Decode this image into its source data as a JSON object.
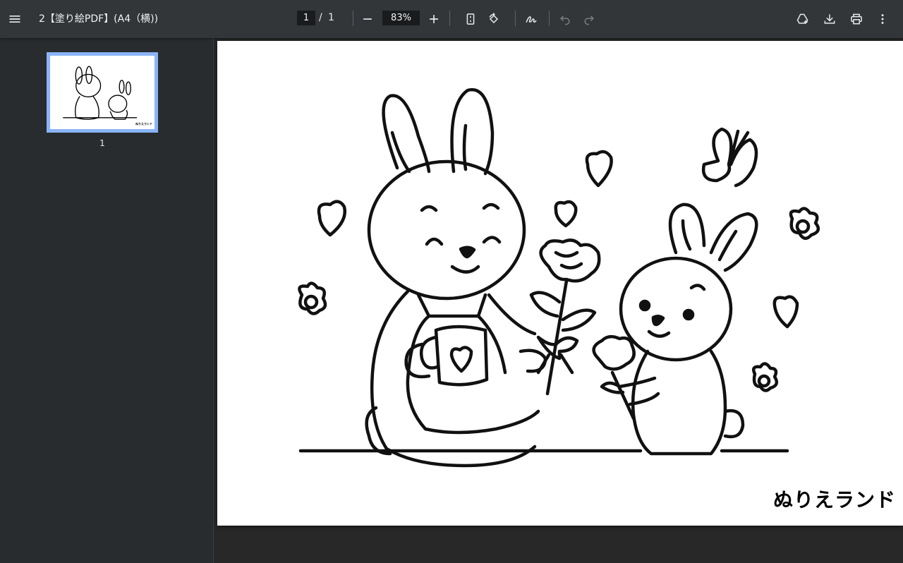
{
  "toolbar": {
    "menu_icon": "hamburger-menu-icon",
    "title": "2【塗り絵PDF】(A4（横))",
    "page_current": "1",
    "page_separator": "/",
    "page_total": "1",
    "zoom_value": "83%",
    "icons": [
      "zoom-out-icon",
      "zoom-in-icon",
      "fit-page-icon",
      "rotate-icon",
      "annotate-icon",
      "undo-icon",
      "redo-icon",
      "add-to-drive-icon",
      "download-icon",
      "print-icon",
      "more-vert-icon"
    ]
  },
  "sidebar": {
    "thumbnails": [
      {
        "page_number": "1",
        "brand": "ぬりえランド"
      }
    ]
  },
  "document": {
    "brand_text": "ぬりえランド",
    "background": "#ffffff"
  },
  "colors": {
    "toolbar_bg": "#323639",
    "sidebar_bg": "#282c2e",
    "viewer_bg": "#282828",
    "thumb_highlight": "#8ab4f8"
  }
}
